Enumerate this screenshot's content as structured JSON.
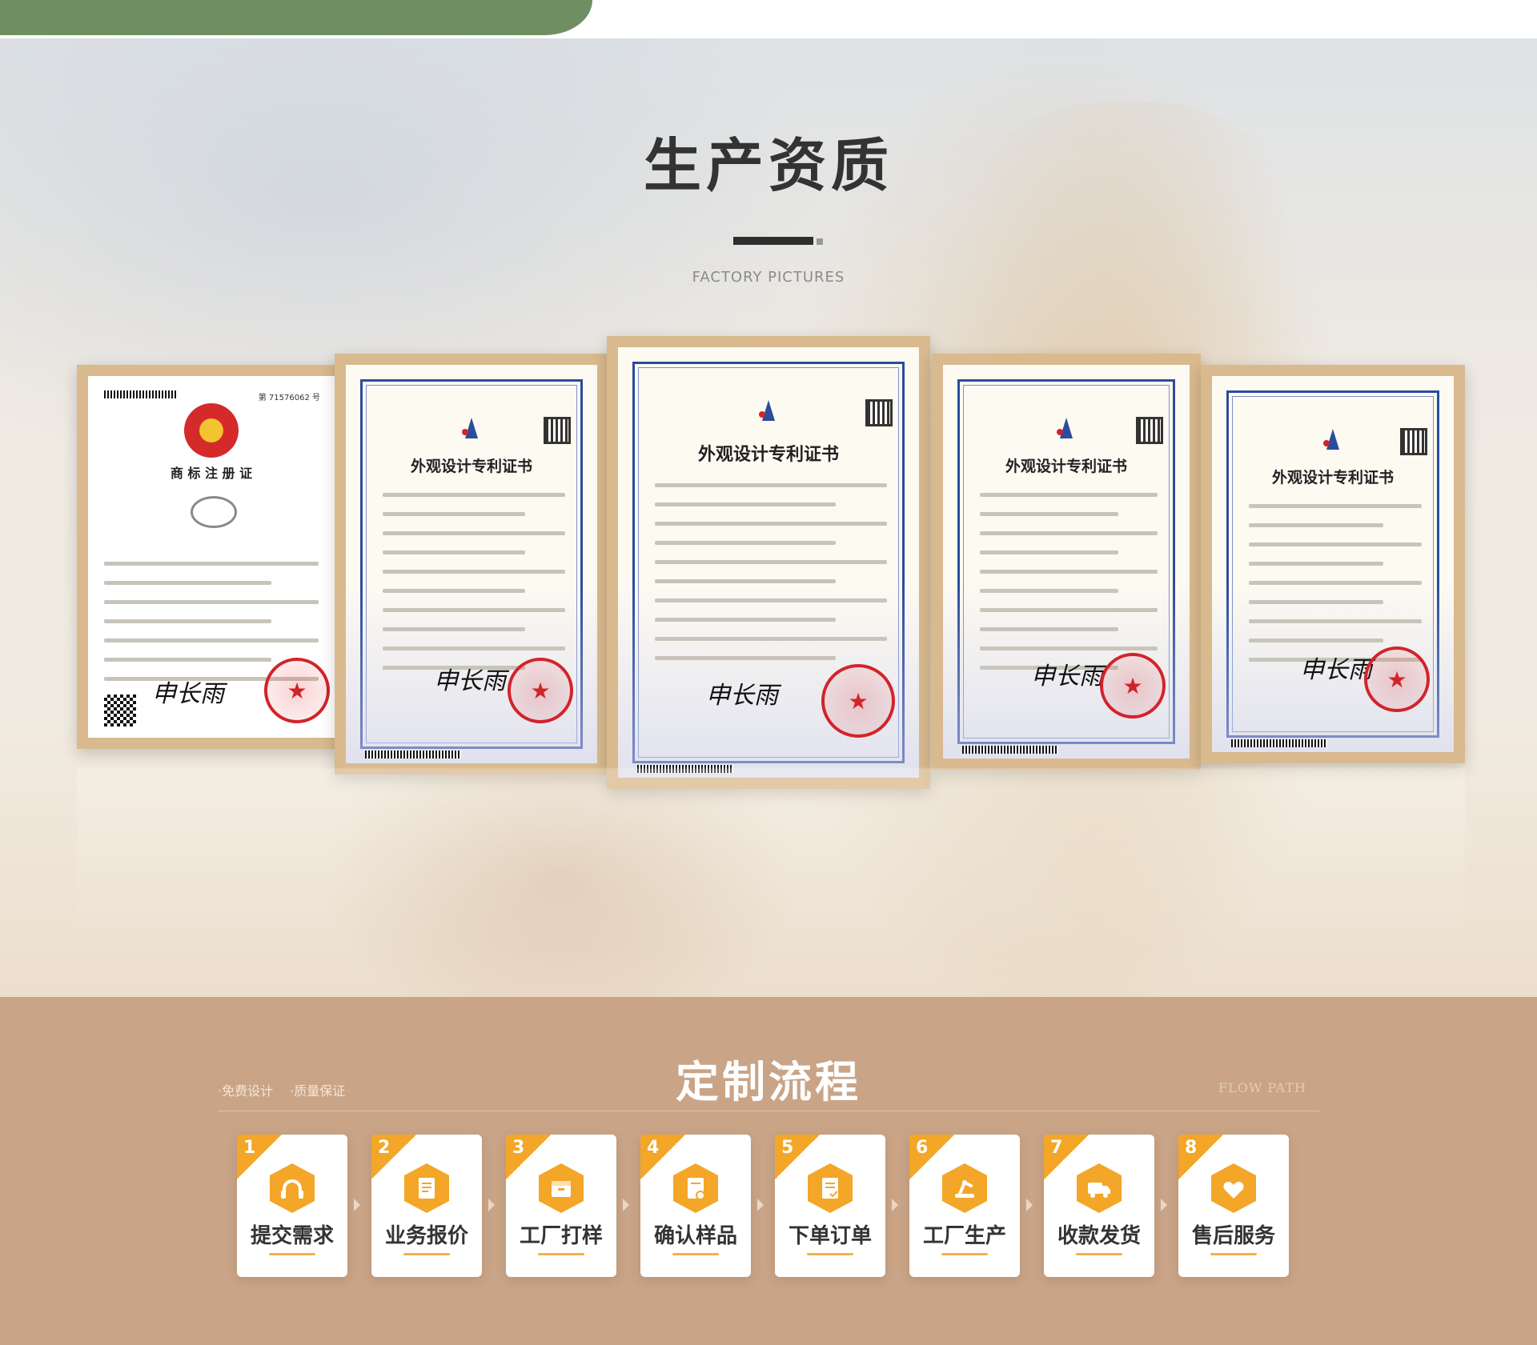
{
  "header": {
    "title": "生产资质",
    "subtitle": "FACTORY PICTURES"
  },
  "certificates": [
    {
      "title": "商 标 注 册 证",
      "number": "第 71576062 号"
    },
    {
      "title": "外观设计专利证书"
    },
    {
      "title": "外观设计专利证书"
    },
    {
      "title": "外观设计专利证书"
    },
    {
      "title": "外观设计专利证书"
    }
  ],
  "process": {
    "title": "定制流程",
    "tags": [
      "·免费设计",
      "·质量保证"
    ],
    "english": "FLOW PATH",
    "steps": [
      {
        "num": "1",
        "label": "提交需求",
        "icon": "headset-icon"
      },
      {
        "num": "2",
        "label": "业务报价",
        "icon": "quote-document-icon"
      },
      {
        "num": "3",
        "label": "工厂打样",
        "icon": "box-icon"
      },
      {
        "num": "4",
        "label": "确认样品",
        "icon": "approve-document-icon"
      },
      {
        "num": "5",
        "label": "下单订单",
        "icon": "order-list-icon"
      },
      {
        "num": "6",
        "label": "工厂生产",
        "icon": "robot-arm-icon"
      },
      {
        "num": "7",
        "label": "收款发货",
        "icon": "delivery-truck-icon"
      },
      {
        "num": "8",
        "label": "售后服务",
        "icon": "heart-handshake-icon"
      }
    ]
  },
  "colors": {
    "accent_orange": "#f3a627",
    "process_bg": "#c9a487",
    "top_green": "#6f8f62"
  }
}
